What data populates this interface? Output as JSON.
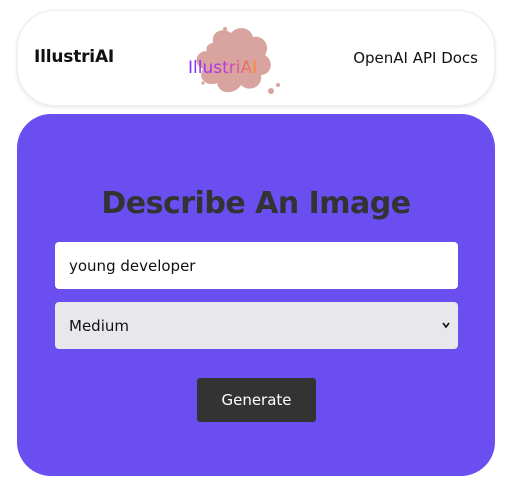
{
  "navbar": {
    "brand": "IllustriAI",
    "logo_text": "IllustriAI",
    "docs_link": "OpenAI API Docs"
  },
  "form": {
    "title": "Describe An Image",
    "prompt_value": "young developer",
    "size_selected": "Medium",
    "generate_label": "Generate"
  },
  "colors": {
    "card_background": "#6b4ef0",
    "button_background": "#333333",
    "logo_splash": "#d9a4a0"
  },
  "icons": {
    "logo": "paint-splash-icon",
    "select": "chevron-down-icon"
  }
}
